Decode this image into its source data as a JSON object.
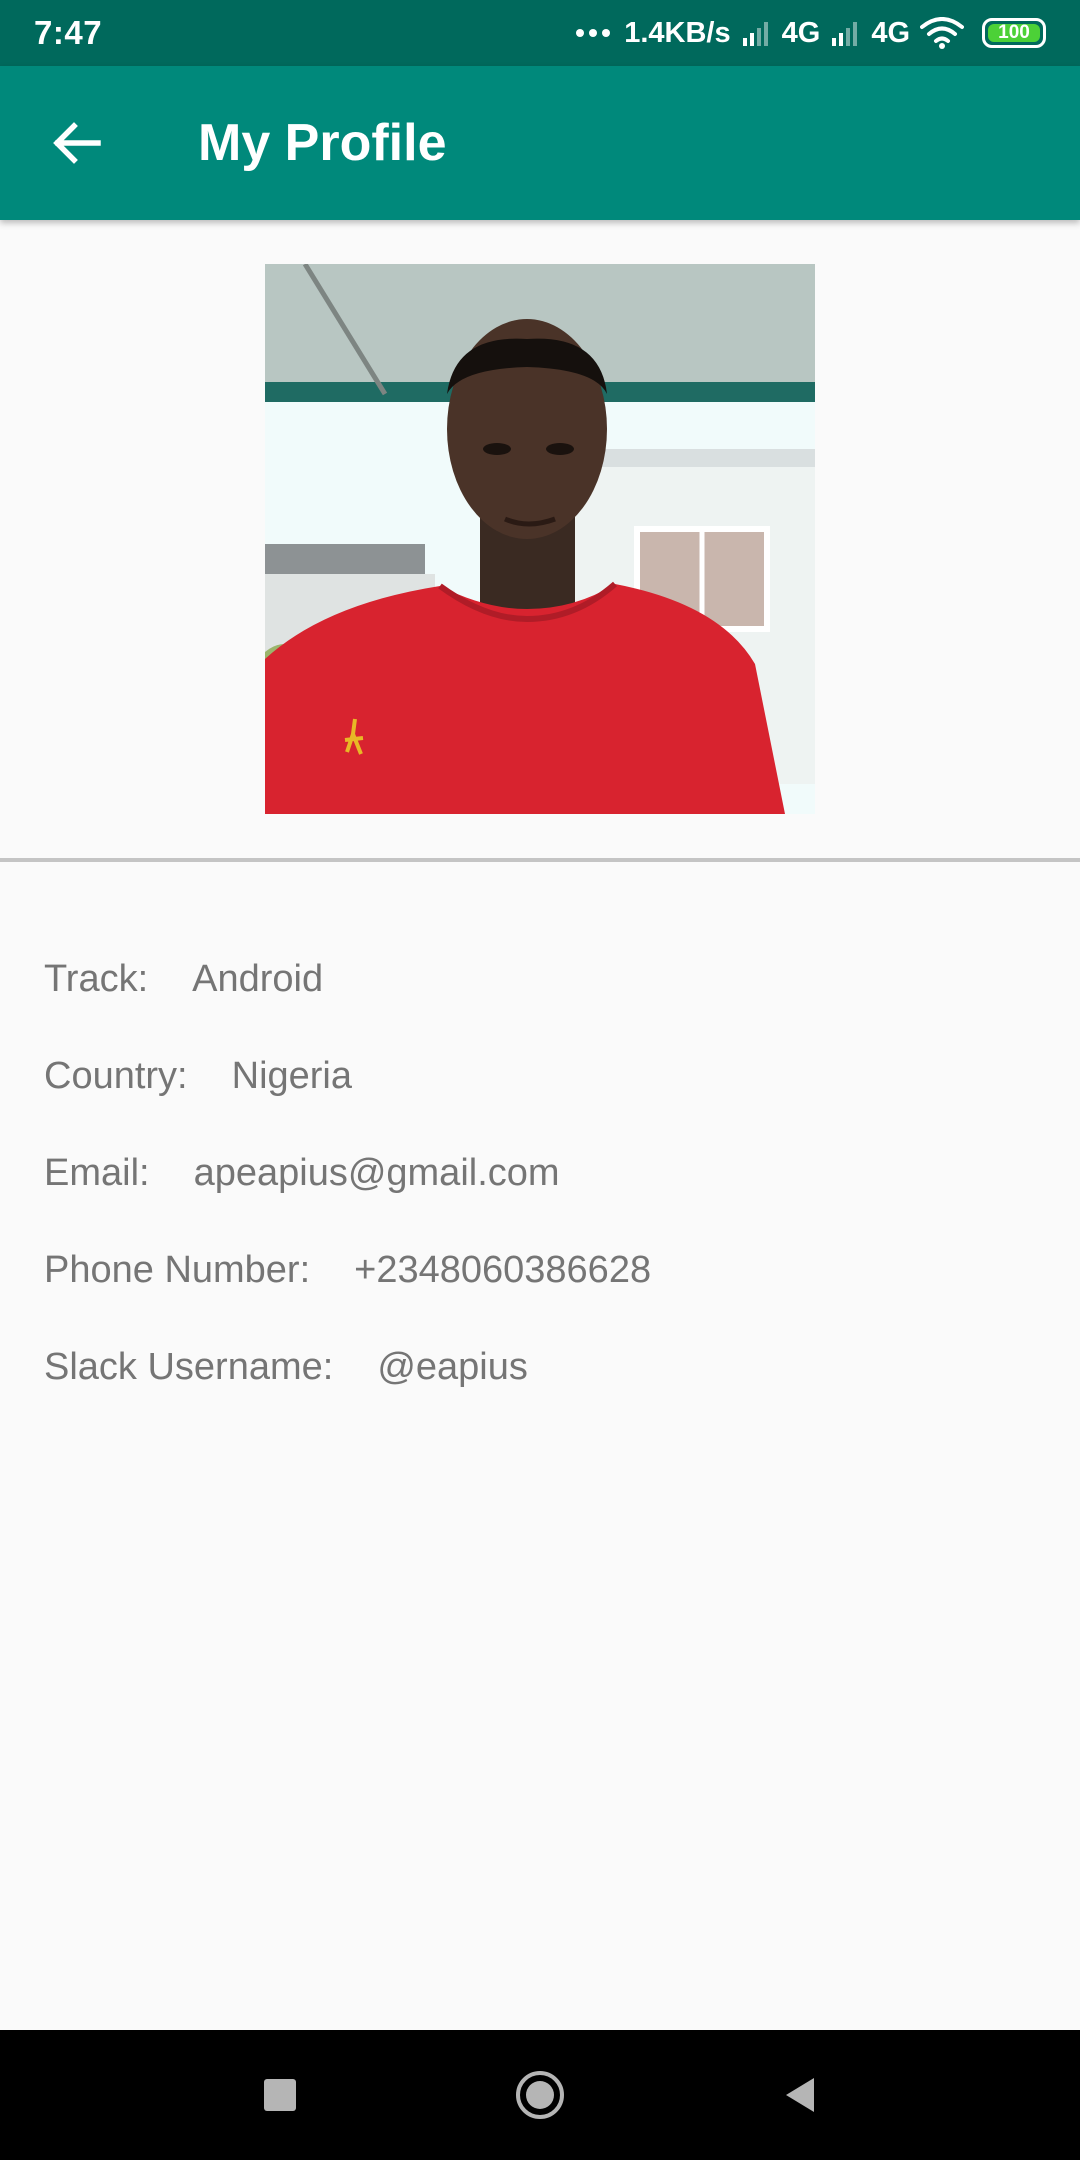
{
  "status_bar": {
    "time": "7:47",
    "speed": "1.4KB/s",
    "net1": "4G",
    "net2": "4G",
    "battery": "100"
  },
  "app_bar": {
    "title": "My Profile",
    "back_icon": "arrow-left-icon"
  },
  "profile": {
    "photo_icon": "profile-photo",
    "fields": [
      {
        "label": "Track:",
        "value": "Android"
      },
      {
        "label": "Country:",
        "value": "Nigeria"
      },
      {
        "label": "Email:",
        "value": "apeapius@gmail.com"
      },
      {
        "label": "Phone Number:",
        "value": "+2348060386628"
      },
      {
        "label": "Slack Username:",
        "value": "@eapius"
      }
    ]
  },
  "nav_bar": {
    "recents_icon": "square-icon",
    "home_icon": "circle-icon",
    "back_icon": "triangle-back-icon"
  },
  "colors": {
    "status_bar": "#00695c",
    "app_bar": "#00897b",
    "text_secondary": "#757575",
    "background": "#fafafa"
  }
}
